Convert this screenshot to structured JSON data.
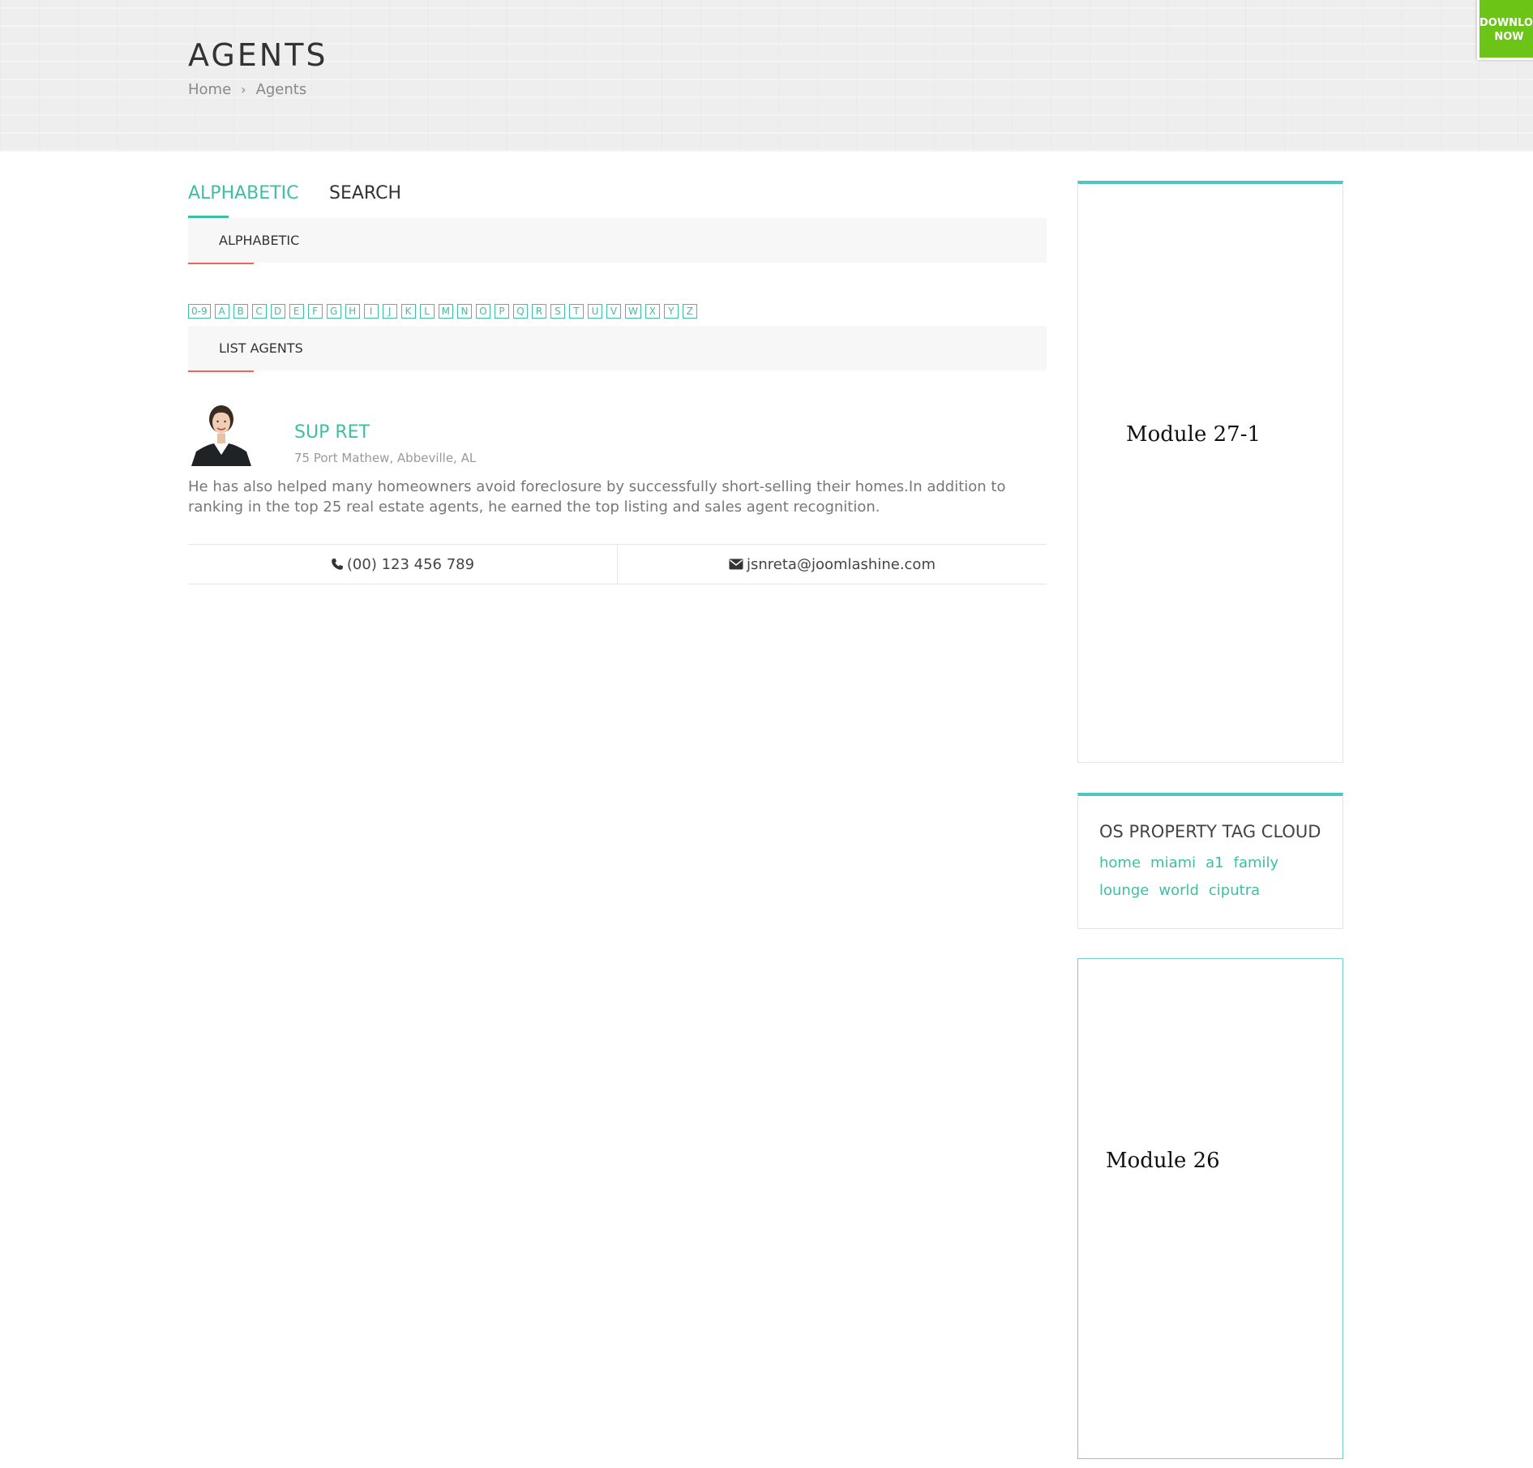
{
  "header": {
    "title": "AGENTS",
    "breadcrumb": [
      "Home",
      "Agents"
    ],
    "download_label_line1": "DOWNLOA",
    "download_label_line2": "NOW"
  },
  "tabs": [
    {
      "label": "ALPHABETIC",
      "active": true
    },
    {
      "label": "SEARCH",
      "active": false
    }
  ],
  "alphabetic_section": {
    "heading": "ALPHABETIC",
    "letters": [
      "0-9",
      "A",
      "B",
      "C",
      "D",
      "E",
      "F",
      "G",
      "H",
      "I",
      "J",
      "K",
      "L",
      "M",
      "N",
      "O",
      "P",
      "Q",
      "R",
      "S",
      "T",
      "U",
      "V",
      "W",
      "X",
      "Y",
      "Z"
    ]
  },
  "list_section": {
    "heading": "LIST AGENTS"
  },
  "agent": {
    "name": "SUP RET",
    "address": "75 Port Mathew, Abbeville, AL",
    "bio": "He has also helped many homeowners avoid foreclosure by successfully short-selling their homes.In addition to ranking in the top 25 real estate agents, he earned the top listing and sales agent recognition.",
    "phone": "(00) 123 456 789",
    "email": "jsnreta@joomlashine.com",
    "phone_icon": "phone-icon",
    "email_icon": "envelope-icon"
  },
  "sidebar": {
    "module_a": "Module 27-1",
    "tag_cloud": {
      "title": "OS PROPERTY TAG CLOUD",
      "tags": [
        "home",
        "miami",
        "a1",
        "family",
        "lounge",
        "world",
        "ciputra"
      ]
    },
    "module_b": "Module 26"
  },
  "colors": {
    "accent": "#3ebfa3",
    "underline_red": "#e8695b",
    "sidebar_top_border": "#4fc7c0",
    "download_green": "#6cc417"
  }
}
